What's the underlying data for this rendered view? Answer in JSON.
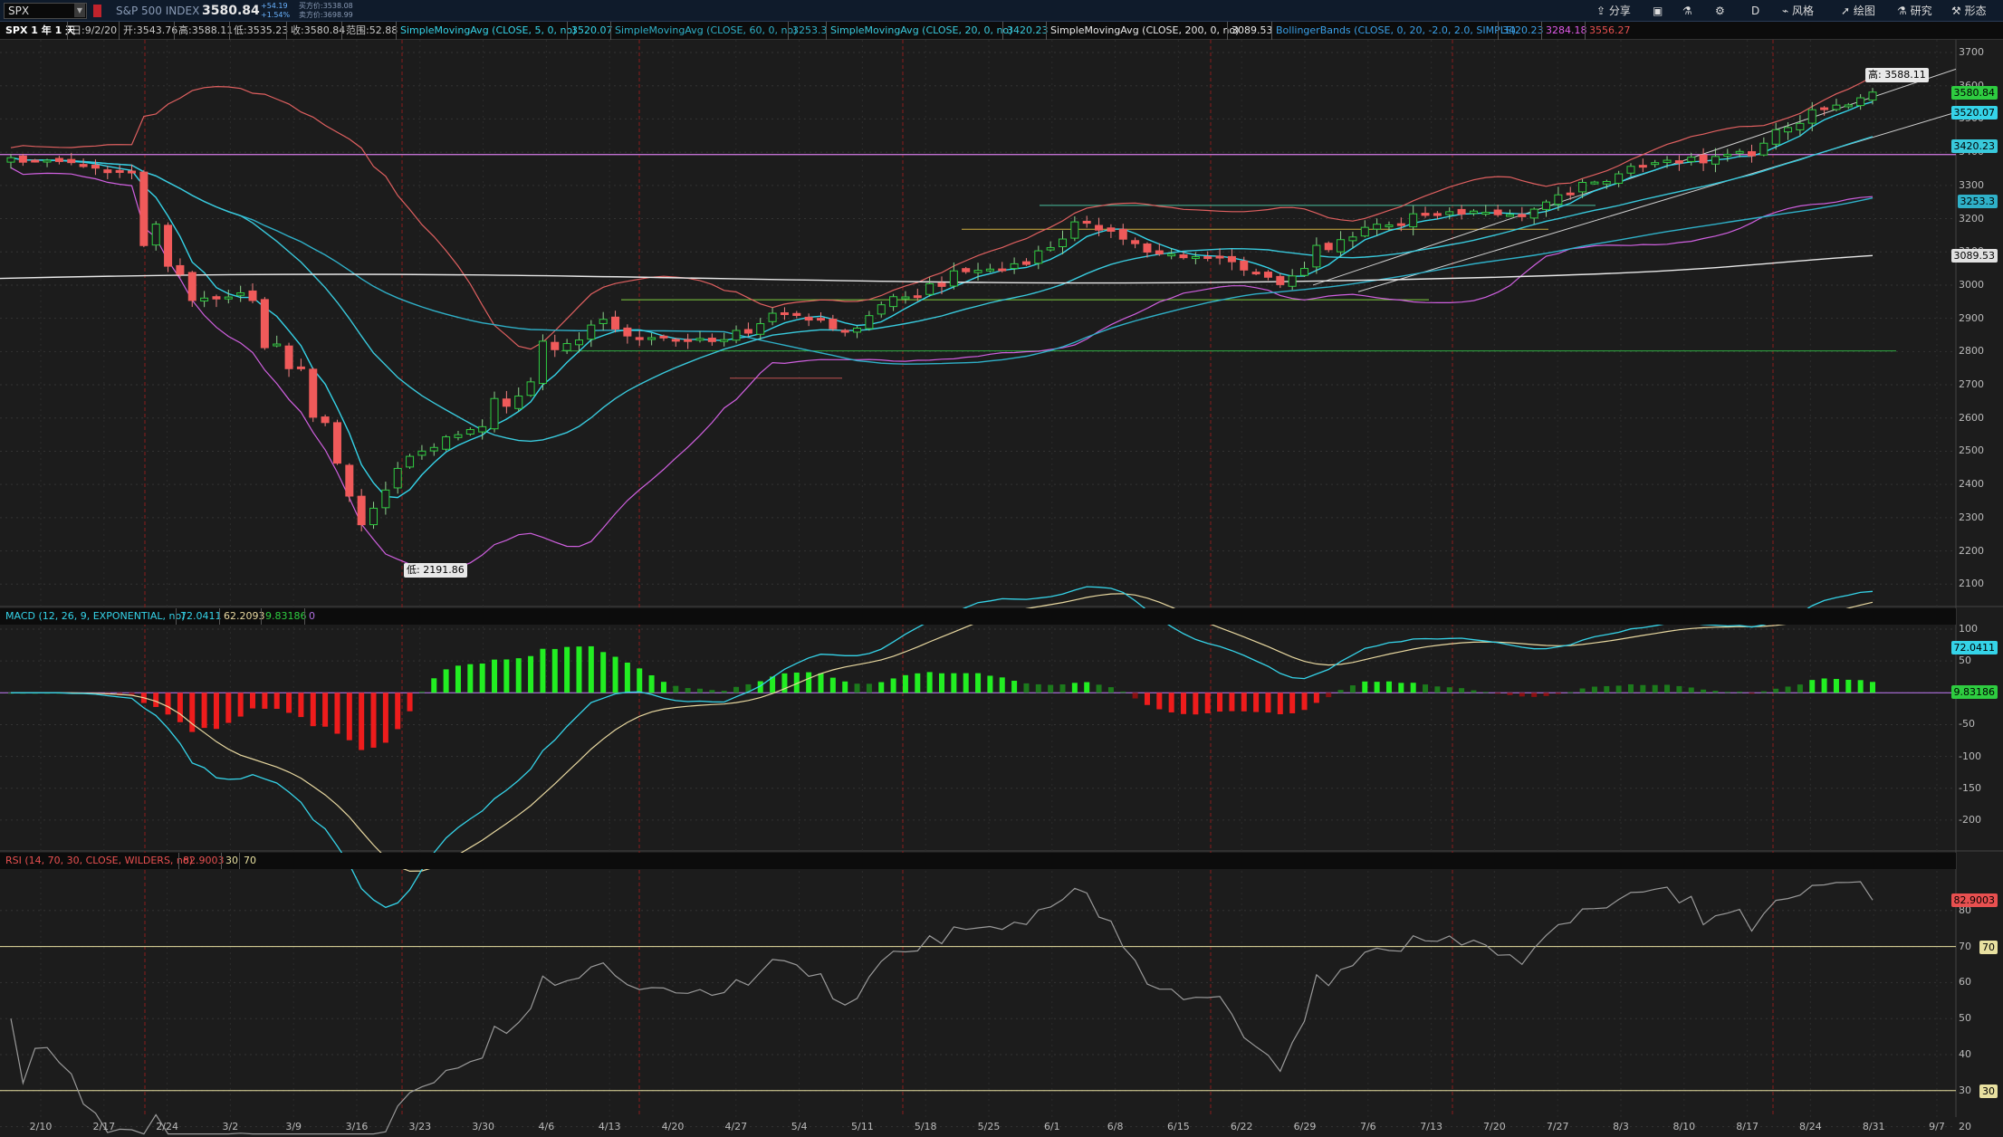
{
  "topbar": {
    "symbol": "SPX",
    "name": "S&P 500 INDEX",
    "last": "3580.84",
    "change": "+54.19",
    "change_pct": "+1.54%",
    "bid": "买方价:3538.08",
    "ask": "卖方价:3698.99",
    "buttons": [
      "分享",
      "风格",
      "绘图",
      "研究",
      "形态"
    ],
    "aggregation": "D"
  },
  "legend": {
    "title": "SPX 1 年 1 天",
    "date": "日:9/2/20",
    "open": "开:3543.76",
    "high": "高:3588.11",
    "low": "低:3535.23",
    "close": "收:3580.84",
    "range": "范围:52.88",
    "studies": [
      {
        "label": "SimpleMovingAvg (CLOSE, 5, 0, no)",
        "value": "3520.07",
        "color": "#35d3e8"
      },
      {
        "label": "SimpleMovingAvg (CLOSE, 60, 0, no)",
        "value": "3253.3",
        "color": "#2fb0c8"
      },
      {
        "label": "SimpleMovingAvg (CLOSE, 20, 0, no)",
        "value": "3420.23",
        "color": "#39c9dc"
      },
      {
        "label": "SimpleMovingAvg (CLOSE, 200, 0, no)",
        "value": "3089.53",
        "color": "#e8e8e8"
      },
      {
        "label": "BollingerBands (CLOSE, 0, 20, -2.0, 2.0, SIMPLE)",
        "value": "3420.23",
        "value2": "3284.18",
        "value3": "3556.27",
        "color": "#3aa0e8"
      }
    ]
  },
  "price_panel": {
    "y_ticks": [
      "3700",
      "3600",
      "3500",
      "3400",
      "3300",
      "3200",
      "3100",
      "3000",
      "2900",
      "2800",
      "2700",
      "2600",
      "2500",
      "2400",
      "2300",
      "2200",
      "2100"
    ],
    "high_label": "高: 3588.11",
    "low_label": "低: 2191.86",
    "tags": [
      {
        "text": "3580.84",
        "color": "#2ecc40"
      },
      {
        "text": "3520.07",
        "color": "#35d3e8"
      },
      {
        "text": "3420.23",
        "color": "#39c9dc"
      },
      {
        "text": "3253.3",
        "color": "#2fb0c8"
      },
      {
        "text": "3089.53",
        "color": "#e0e0e0"
      }
    ]
  },
  "macd": {
    "label": "MACD (12, 26, 9, EXPONENTIAL, no)",
    "value": "72.0411",
    "avg": "62.2093",
    "diff": "9.83186",
    "zero": "0",
    "y_ticks": [
      "100",
      "50",
      "0",
      "-50",
      "-100",
      "-150",
      "-200"
    ],
    "tags": [
      {
        "text": "72.0411",
        "color": "#35d3e8"
      },
      {
        "text": "9.83186",
        "color": "#2ecc40"
      }
    ]
  },
  "rsi": {
    "label": "RSI (14, 70, 30, CLOSE, WILDERS, no)",
    "value": "82.9003",
    "oversold": "30",
    "overbought": "70",
    "y_ticks": [
      "80",
      "70",
      "60",
      "50",
      "40",
      "30",
      "20"
    ],
    "tags": [
      {
        "text": "82.9003",
        "color": "#e85050"
      },
      {
        "text": "70",
        "color": "#e8e0a0"
      },
      {
        "text": "30",
        "color": "#e8e0a0"
      }
    ]
  },
  "x_ticks": [
    "2/10",
    "2/17",
    "2/24",
    "3/2",
    "3/9",
    "3/16",
    "3/23",
    "3/30",
    "4/6",
    "4/13",
    "4/20",
    "4/27",
    "5/4",
    "5/11",
    "5/18",
    "5/25",
    "6/1",
    "6/8",
    "6/15",
    "6/22",
    "6/29",
    "7/6",
    "7/13",
    "7/20",
    "7/27",
    "8/3",
    "8/10",
    "8/17",
    "8/24",
    "8/31",
    "9/7"
  ],
  "chart_data": {
    "type": "candlestick",
    "title": "SPX 1 年 1 天",
    "x_range": [
      "2/10",
      "9/7"
    ],
    "ylim": [
      2100,
      3700
    ],
    "series": [
      {
        "name": "SimpleMovingAvg (CLOSE, 5, 0, no)",
        "last": 3520.07
      },
      {
        "name": "SimpleMovingAvg (CLOSE, 20, 0, no)",
        "last": 3420.23
      },
      {
        "name": "SimpleMovingAvg (CLOSE, 60, 0, no)",
        "last": 3253.3
      },
      {
        "name": "SimpleMovingAvg (CLOSE, 200, 0, no)",
        "last": 3089.53
      },
      {
        "name": "BollingerBands (CLOSE, 0, 20, -2.0, 2.0, SIMPLE)",
        "last": [
          3420.23,
          3284.18,
          3556.27
        ]
      }
    ],
    "weekly_closes": [
      3380,
      3370,
      3337,
      2954,
      2972,
      2711,
      2305,
      2489,
      2583,
      2790,
      2875,
      2837,
      2830,
      2929,
      2864,
      2955,
      3044,
      3055,
      3193,
      3097,
      3083,
      3009,
      3130,
      3185,
      3224,
      3216,
      3271,
      3351,
      3372,
      3397,
      3508,
      3580
    ],
    "high": 3588.11,
    "low": 2191.86,
    "macd_last": 72.0411,
    "macd_avg_last": 62.2093,
    "rsi_last": 82.9003
  }
}
